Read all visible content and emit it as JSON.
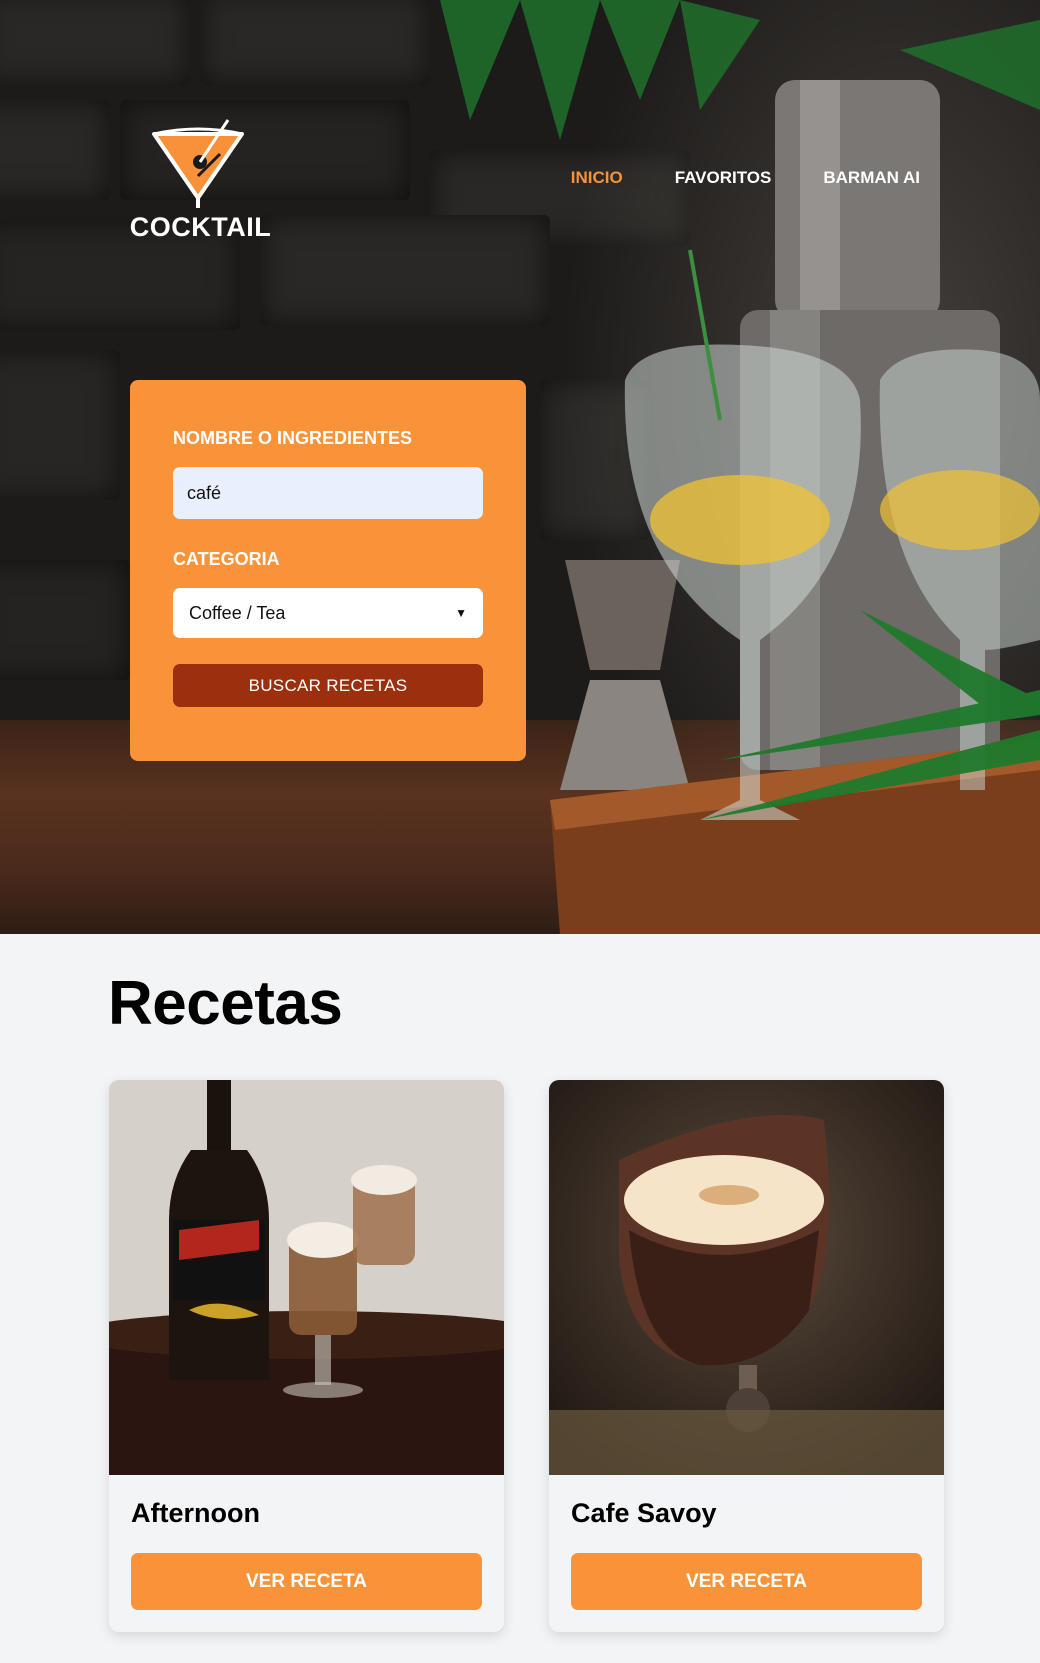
{
  "brand": {
    "name": "COCKTAIL",
    "logo_icon": "martini-glass-icon"
  },
  "nav": {
    "items": [
      {
        "label": "INICIO",
        "active": true
      },
      {
        "label": "FAVORITOS",
        "active": false
      },
      {
        "label": "BARMAN AI",
        "active": false
      }
    ]
  },
  "search": {
    "name_label": "NOMBRE O INGREDIENTES",
    "name_value": "café",
    "category_label": "CATEGORIA",
    "category_value": "Coffee / Tea",
    "submit_label": "BUSCAR RECETAS"
  },
  "recipes": {
    "title": "Recetas",
    "items": [
      {
        "name": "Afternoon",
        "button": "VER RECETA",
        "image_icon": "baileys-coffee-photo"
      },
      {
        "name": "Cafe Savoy",
        "button": "VER RECETA",
        "image_icon": "coffee-cocktail-photo"
      }
    ]
  },
  "colors": {
    "accent": "#f99339",
    "active_nav": "#f7923a",
    "search_button": "#9b2f0e",
    "input_bg": "#e8f0fe",
    "page_bg": "#f3f4f6"
  }
}
